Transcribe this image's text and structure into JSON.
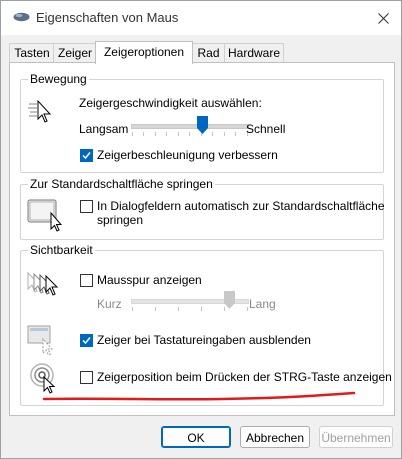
{
  "window": {
    "title": "Eigenschaften von Maus"
  },
  "tabs": [
    {
      "label": "Tasten"
    },
    {
      "label": "Zeiger"
    },
    {
      "label": "Zeigeroptionen"
    },
    {
      "label": "Rad"
    },
    {
      "label": "Hardware"
    }
  ],
  "active_tab": "Zeigeroptionen",
  "motion": {
    "group_label": "Bewegung",
    "speed_label": "Zeigergeschwindigkeit auswählen:",
    "slow_label": "Langsam",
    "fast_label": "Schnell",
    "speed_value": 0.5,
    "enhance_label": "Zeigerbeschleunigung verbessern",
    "enhance_checked": true
  },
  "snap": {
    "group_label": "Zur Standardschaltfläche springen",
    "label_line1": "In Dialogfeldern automatisch zur Standardschaltfläche",
    "label_line2": "springen",
    "checked": false
  },
  "visibility": {
    "group_label": "Sichtbarkeit",
    "trails_label": "Mausspur anzeigen",
    "trails_checked": false,
    "short_label": "Kurz",
    "long_label": "Lang",
    "hide_label": "Zeiger bei Tastatureingaben ausblenden",
    "hide_checked": true,
    "ctrl_label": "Zeigerposition beim Drücken der STRG-Taste anzeigen",
    "ctrl_checked": false
  },
  "buttons": {
    "ok": "OK",
    "cancel": "Abbrechen",
    "apply": "Übernehmen"
  },
  "colors": {
    "accent": "#0067c0",
    "annotation": "#e11b1b"
  }
}
